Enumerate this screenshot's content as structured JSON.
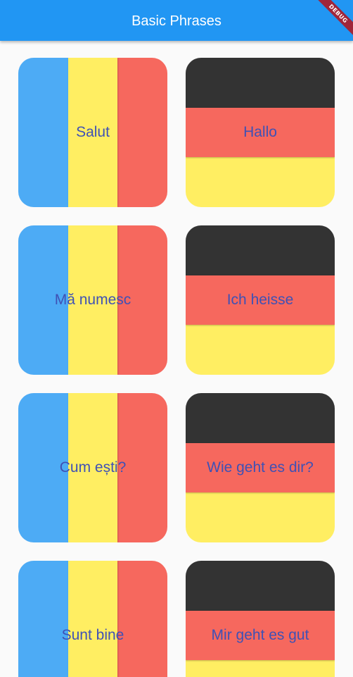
{
  "appbar": {
    "title": "Basic Phrases",
    "debug_label": "DEBUG"
  },
  "colors": {
    "appbar": "#2196f3",
    "label_text": "#3f51b5",
    "romania": [
      "#4dabf5",
      "#ffee62",
      "#f6685e"
    ],
    "germany": [
      "#333333",
      "#f6685e",
      "#ffee62"
    ]
  },
  "phrases": [
    {
      "romanian": "Salut",
      "german": "Hallo"
    },
    {
      "romanian": "Mă numesc",
      "german": "Ich heisse"
    },
    {
      "romanian": "Cum ești?",
      "german": "Wie geht es dir?"
    },
    {
      "romanian": "Sunt bine",
      "german": "Mir geht es gut"
    }
  ]
}
